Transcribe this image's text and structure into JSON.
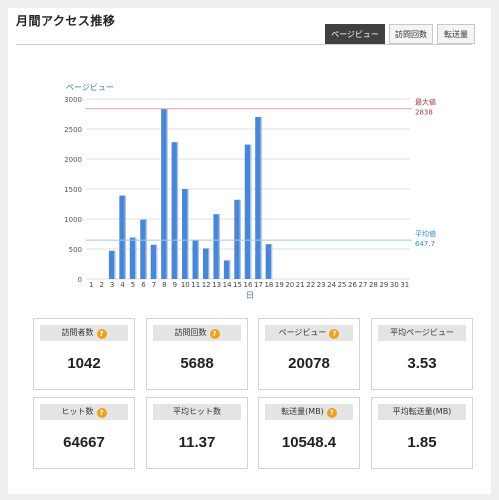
{
  "page": {
    "title": "月間アクセス推移",
    "tabs": [
      {
        "label": "ページビュー",
        "active": true
      },
      {
        "label": "訪問回数",
        "active": false
      },
      {
        "label": "転送量",
        "active": false
      }
    ]
  },
  "chart_data": {
    "type": "bar",
    "ylabel": "ページビュー",
    "xlabel": "日",
    "ylim": [
      0,
      3000
    ],
    "yticks": [
      0,
      500,
      1000,
      1500,
      2000,
      2500,
      3000
    ],
    "categories": [
      "1",
      "2",
      "3",
      "4",
      "5",
      "6",
      "7",
      "8",
      "9",
      "10",
      "11",
      "12",
      "13",
      "14",
      "15",
      "16",
      "17",
      "18",
      "19",
      "20",
      "21",
      "22",
      "23",
      "24",
      "25",
      "26",
      "27",
      "28",
      "29",
      "30",
      "31"
    ],
    "values": [
      0,
      0,
      470,
      1390,
      690,
      990,
      570,
      2838,
      2280,
      1500,
      650,
      510,
      1080,
      310,
      1320,
      2240,
      2700,
      580,
      0,
      0,
      0,
      0,
      0,
      0,
      0,
      0,
      0,
      0,
      0,
      0,
      0
    ],
    "reference_lines": [
      {
        "label": "最大値",
        "value_text": "2838",
        "value": 2838,
        "color": "#e8a0a0",
        "text_color": "#a04040"
      },
      {
        "label": "平均値",
        "value_text": "647.7",
        "value": 647.7,
        "color": "#9ccbe6",
        "text_color": "#3a8bc4"
      }
    ],
    "bar_color": "#4a86d4",
    "grid": true
  },
  "stats": [
    {
      "label": "訪問者数",
      "value": "1042",
      "help": true
    },
    {
      "label": "訪問回数",
      "value": "5688",
      "help": true
    },
    {
      "label": "ページビュー",
      "value": "20078",
      "help": true
    },
    {
      "label": "平均ページビュー",
      "value": "3.53",
      "help": false
    },
    {
      "label": "ヒット数",
      "value": "64667",
      "help": true
    },
    {
      "label": "平均ヒット数",
      "value": "11.37",
      "help": false
    },
    {
      "label": "転送量(MB)",
      "value": "10548.4",
      "help": true
    },
    {
      "label": "平均転送量(MB)",
      "value": "1.85",
      "help": false
    }
  ],
  "help_glyph": "?"
}
